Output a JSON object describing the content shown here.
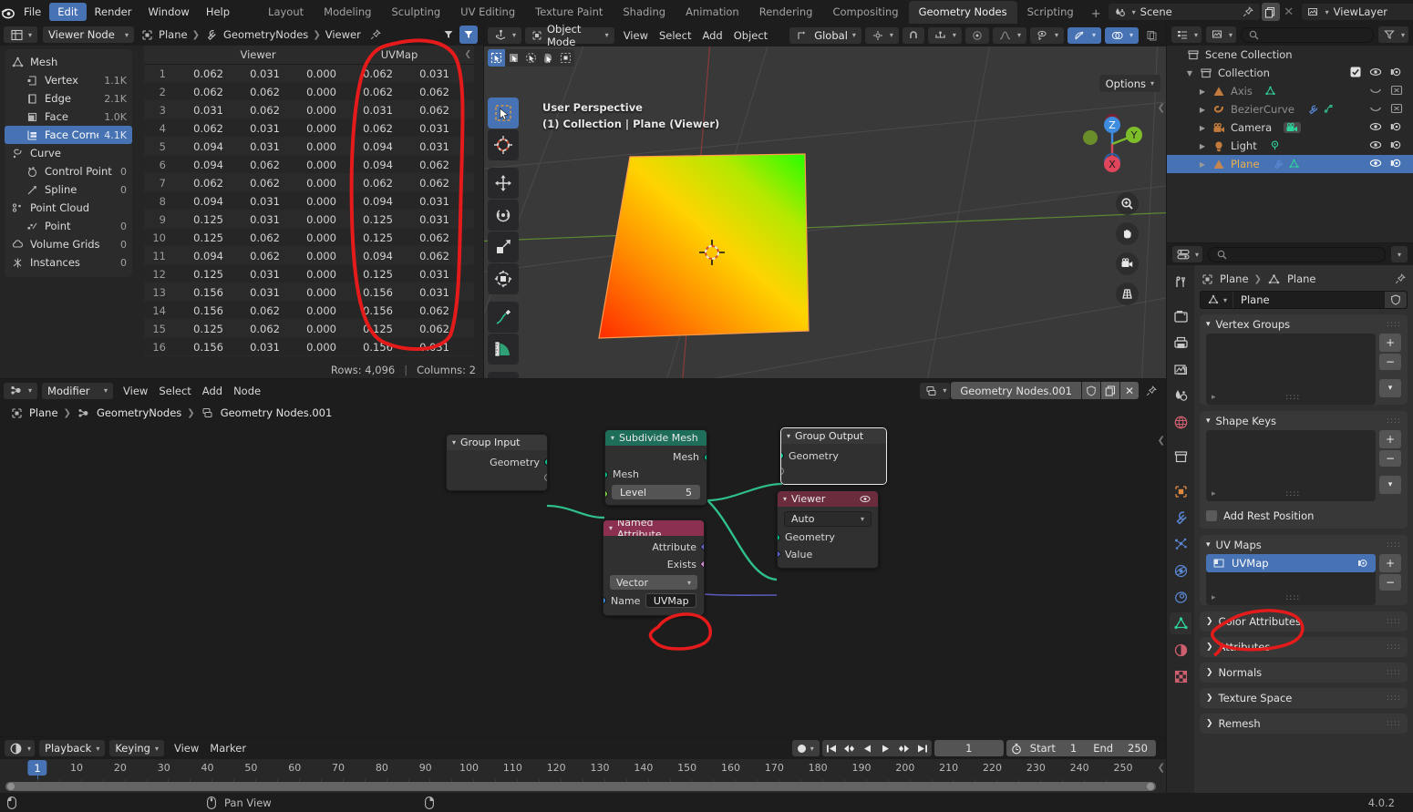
{
  "app": {
    "version": "4.0.2"
  },
  "topbar": {
    "menus": [
      "File",
      "Edit",
      "Render",
      "Window",
      "Help"
    ],
    "active_menu": "Edit",
    "workspaces": [
      "Layout",
      "Modeling",
      "Sculpting",
      "UV Editing",
      "Texture Paint",
      "Shading",
      "Animation",
      "Rendering",
      "Compositing",
      "Geometry Nodes",
      "Scripting"
    ],
    "active_workspace": "Geometry Nodes",
    "add_workspace": "+",
    "scene_name": "Scene",
    "viewlayer_name": "ViewLayer"
  },
  "spreadsheet": {
    "editor_type_icon": "spreadsheet-editor-icon",
    "mode": "Viewer Node",
    "breadcrumb": [
      "Plane",
      "GeometryNodes",
      "Viewer"
    ],
    "datasets": [
      {
        "label": "Mesh",
        "count": "",
        "icon": "mesh-icon",
        "indent": false,
        "selected": false
      },
      {
        "label": "Vertex",
        "count": "1.1K",
        "icon": "vertex-icon",
        "indent": true,
        "selected": false
      },
      {
        "label": "Edge",
        "count": "2.1K",
        "icon": "edge-icon",
        "indent": true,
        "selected": false
      },
      {
        "label": "Face",
        "count": "1.0K",
        "icon": "face-icon",
        "indent": true,
        "selected": false
      },
      {
        "label": "Face Corner",
        "count": "4.1K",
        "icon": "face-corner-icon",
        "indent": true,
        "selected": true
      },
      {
        "label": "Curve",
        "count": "",
        "icon": "curve-icon",
        "indent": false,
        "selected": false
      },
      {
        "label": "Control Point",
        "count": "0",
        "icon": "control-point-icon",
        "indent": true,
        "selected": false
      },
      {
        "label": "Spline",
        "count": "0",
        "icon": "spline-icon",
        "indent": true,
        "selected": false
      },
      {
        "label": "Point Cloud",
        "count": "",
        "icon": "point-cloud-icon",
        "indent": false,
        "selected": false
      },
      {
        "label": "Point",
        "count": "0",
        "icon": "point-icon",
        "indent": true,
        "selected": false
      },
      {
        "label": "Volume Grids",
        "count": "0",
        "icon": "volume-grids-icon",
        "indent": false,
        "selected": false
      },
      {
        "label": "Instances",
        "count": "0",
        "icon": "instances-icon",
        "indent": false,
        "selected": false
      }
    ],
    "column_groups": [
      {
        "label": "Viewer",
        "span": 3
      },
      {
        "label": "UVMap",
        "span": 2
      }
    ],
    "rows": [
      {
        "index": 1,
        "viewer": [
          "0.062",
          "0.031",
          "0.000"
        ],
        "uvmap": [
          "0.062",
          "0.031"
        ]
      },
      {
        "index": 2,
        "viewer": [
          "0.062",
          "0.062",
          "0.000"
        ],
        "uvmap": [
          "0.062",
          "0.062"
        ]
      },
      {
        "index": 3,
        "viewer": [
          "0.031",
          "0.062",
          "0.000"
        ],
        "uvmap": [
          "0.031",
          "0.062"
        ]
      },
      {
        "index": 4,
        "viewer": [
          "0.062",
          "0.031",
          "0.000"
        ],
        "uvmap": [
          "0.062",
          "0.031"
        ]
      },
      {
        "index": 5,
        "viewer": [
          "0.094",
          "0.031",
          "0.000"
        ],
        "uvmap": [
          "0.094",
          "0.031"
        ]
      },
      {
        "index": 6,
        "viewer": [
          "0.094",
          "0.062",
          "0.000"
        ],
        "uvmap": [
          "0.094",
          "0.062"
        ]
      },
      {
        "index": 7,
        "viewer": [
          "0.062",
          "0.062",
          "0.000"
        ],
        "uvmap": [
          "0.062",
          "0.062"
        ]
      },
      {
        "index": 8,
        "viewer": [
          "0.094",
          "0.031",
          "0.000"
        ],
        "uvmap": [
          "0.094",
          "0.031"
        ]
      },
      {
        "index": 9,
        "viewer": [
          "0.125",
          "0.031",
          "0.000"
        ],
        "uvmap": [
          "0.125",
          "0.031"
        ]
      },
      {
        "index": 10,
        "viewer": [
          "0.125",
          "0.062",
          "0.000"
        ],
        "uvmap": [
          "0.125",
          "0.062"
        ]
      },
      {
        "index": 11,
        "viewer": [
          "0.094",
          "0.062",
          "0.000"
        ],
        "uvmap": [
          "0.094",
          "0.062"
        ]
      },
      {
        "index": 12,
        "viewer": [
          "0.125",
          "0.031",
          "0.000"
        ],
        "uvmap": [
          "0.125",
          "0.031"
        ]
      },
      {
        "index": 13,
        "viewer": [
          "0.156",
          "0.031",
          "0.000"
        ],
        "uvmap": [
          "0.156",
          "0.031"
        ]
      },
      {
        "index": 14,
        "viewer": [
          "0.156",
          "0.062",
          "0.000"
        ],
        "uvmap": [
          "0.156",
          "0.062"
        ]
      },
      {
        "index": 15,
        "viewer": [
          "0.125",
          "0.062",
          "0.000"
        ],
        "uvmap": [
          "0.125",
          "0.062"
        ]
      },
      {
        "index": 16,
        "viewer": [
          "0.156",
          "0.031",
          "0.000"
        ],
        "uvmap": [
          "0.156",
          "0.031"
        ]
      }
    ],
    "footer": {
      "rows": "Rows: 4,096",
      "sep": "|",
      "columns": "Columns: 2"
    }
  },
  "viewport": {
    "mode": "Object Mode",
    "menus": [
      "View",
      "Select",
      "Add",
      "Object"
    ],
    "transform_orientation": "Global",
    "options_label": "Options",
    "overlay_title": "User Perspective",
    "overlay_subtitle": "(1) Collection | Plane (Viewer)",
    "gizmo_axes": [
      "X",
      "Y",
      "Z"
    ],
    "plane_gradient": {
      "from": "#ff3300",
      "mid": "#f2d400",
      "to": "#2bff00"
    }
  },
  "node_editor": {
    "mode": "Modifier",
    "menus": [
      "View",
      "Select",
      "Add",
      "Node"
    ],
    "nodetree_name": "Geometry Nodes.001",
    "breadcrumb": [
      "Plane",
      "GeometryNodes",
      "Geometry Nodes.001"
    ],
    "nodes": [
      {
        "name": "Group Input",
        "header_color": "#383838",
        "outputs": [
          "Geometry"
        ],
        "inputs": [],
        "fields": []
      },
      {
        "name": "Subdivide Mesh",
        "header_color": "#1f6e5b",
        "outputs": [
          "Mesh"
        ],
        "inputs": [
          "Mesh"
        ],
        "fields": [
          {
            "label": "Level",
            "value": "5"
          }
        ]
      },
      {
        "name": "Group Output",
        "header_color": "#383838",
        "outputs": [],
        "inputs": [
          "Geometry"
        ],
        "fields": []
      },
      {
        "name": "Viewer",
        "header_color": "#6b2c3e",
        "dropdown": "Auto",
        "inputs": [
          "Geometry",
          "Value"
        ],
        "outputs": [],
        "fields": []
      },
      {
        "name": "Named Attribute",
        "header_color": "#8c3052",
        "outputs": [
          "Attribute",
          "Exists"
        ],
        "inputs": [
          "Name"
        ],
        "dropdown": "Vector",
        "name_value": "UVMap",
        "fields": []
      }
    ]
  },
  "outliner": {
    "search_placeholder": "",
    "rows": [
      {
        "label": "Scene Collection",
        "icon": "collection-icon",
        "depth": 0,
        "selected": false,
        "disclosure": "",
        "dim": false
      },
      {
        "label": "Collection",
        "icon": "collection-icon",
        "depth": 1,
        "selected": false,
        "disclosure": "▼",
        "dim": false
      },
      {
        "label": "Axis",
        "icon": "mesh-object-icon",
        "depth": 2,
        "selected": false,
        "disclosure": "▶",
        "dim": true
      },
      {
        "label": "BezierCurve",
        "icon": "curve-object-icon",
        "depth": 2,
        "selected": false,
        "disclosure": "▶",
        "dim": true
      },
      {
        "label": "Camera",
        "icon": "camera-object-icon",
        "depth": 2,
        "selected": false,
        "disclosure": "▶",
        "dim": false
      },
      {
        "label": "Light",
        "icon": "light-object-icon",
        "depth": 2,
        "selected": false,
        "disclosure": "▶",
        "dim": false
      },
      {
        "label": "Plane",
        "icon": "mesh-object-icon",
        "depth": 2,
        "selected": true,
        "disclosure": "▶",
        "dim": false
      }
    ]
  },
  "properties": {
    "search_placeholder": "",
    "breadcrumb": [
      "Plane",
      "Plane"
    ],
    "datablock_name": "Plane",
    "panels": [
      {
        "label": "Vertex Groups",
        "open": true
      },
      {
        "label": "Shape Keys",
        "open": true
      },
      {
        "label": "UV Maps",
        "open": true
      },
      {
        "label": "Color Attributes",
        "open": false
      },
      {
        "label": "Attributes",
        "open": false
      },
      {
        "label": "Normals",
        "open": false
      },
      {
        "label": "Texture Space",
        "open": false
      },
      {
        "label": "Remesh",
        "open": false
      }
    ],
    "add_rest_position": "Add Rest Position",
    "uv_map_item": "UVMap",
    "add_btn": "+",
    "remove_btn": "−"
  },
  "timeline": {
    "menus": [
      "View",
      "Marker"
    ],
    "playback": "Playback",
    "keying": "Keying",
    "current_frame": "1",
    "start_label": "Start",
    "start_value": "1",
    "end_label": "End",
    "end_value": "250",
    "ticks": [
      1,
      10,
      20,
      30,
      40,
      50,
      60,
      70,
      80,
      90,
      100,
      110,
      120,
      130,
      140,
      150,
      160,
      170,
      180,
      190,
      200,
      210,
      220,
      230,
      240,
      250
    ]
  },
  "status_bar": {
    "hint": "Pan View",
    "version": "4.0.2"
  }
}
